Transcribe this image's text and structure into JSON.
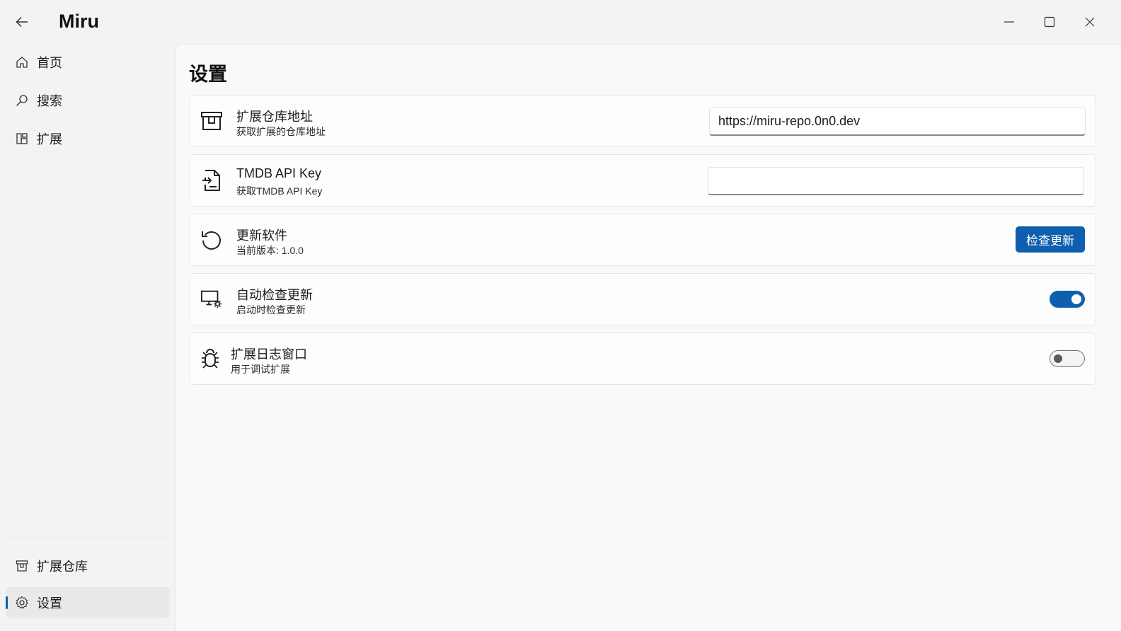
{
  "window": {
    "title": "Miru",
    "icons": {
      "back": "back-arrow-icon",
      "minimize": "minimize-icon",
      "maximize": "maximize-icon",
      "close": "close-icon"
    }
  },
  "sidebar": {
    "items": [
      {
        "label": "首页",
        "icon": "home-icon"
      },
      {
        "label": "搜索",
        "icon": "search-icon"
      },
      {
        "label": "扩展",
        "icon": "extensions-icon"
      }
    ],
    "footer_items": [
      {
        "label": "扩展仓库",
        "icon": "repository-icon"
      },
      {
        "label": "设置",
        "icon": "gear-icon",
        "selected": true
      }
    ]
  },
  "settings": {
    "title": "设置",
    "cards": [
      {
        "title": "扩展仓库地址",
        "subtitle": "获取扩展的仓库地址",
        "icon": "repository-icon",
        "control": "text-input",
        "value": "https://miru-repo.0n0.dev"
      },
      {
        "title": "TMDB API Key",
        "subtitle": "获取TMDB API Key",
        "icon": "document-icon",
        "control": "text-input",
        "value": ""
      },
      {
        "title": "更新软件",
        "subtitle": "当前版本: 1.0.0",
        "icon": "refresh-icon",
        "control": "button",
        "button_label": "检查更新"
      },
      {
        "title": "自动检查更新",
        "subtitle": "启动时检查更新",
        "icon": "monitor-settings-icon",
        "control": "toggle",
        "on": true
      },
      {
        "title": "扩展日志窗口",
        "subtitle": "用于调试扩展",
        "icon": "bug-icon",
        "control": "toggle",
        "on": false
      }
    ]
  },
  "colors": {
    "accent": "#0f5fae",
    "window_bg": "#f3f3f3",
    "content_bg": "#f9f9f9",
    "card_bg": "#fdfdfd"
  }
}
